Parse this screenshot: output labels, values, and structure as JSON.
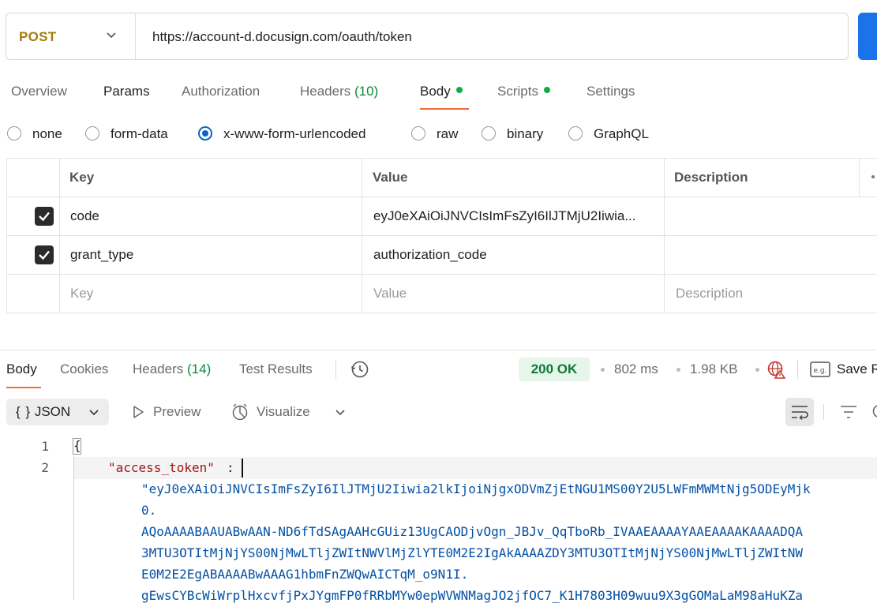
{
  "request": {
    "method": "POST",
    "url": "https://account-d.docusign.com/oauth/token"
  },
  "request_tabs": {
    "overview": "Overview",
    "params": "Params",
    "authorization": "Authorization",
    "headers": "Headers",
    "headers_count": "(10)",
    "body": "Body",
    "scripts": "Scripts",
    "settings": "Settings"
  },
  "body_types": {
    "none": "none",
    "form_data": "form-data",
    "urlencoded": "x-www-form-urlencoded",
    "raw": "raw",
    "binary": "binary",
    "graphql": "GraphQL",
    "selected": "x-www-form-urlencoded"
  },
  "params_table": {
    "headers": {
      "key": "Key",
      "value": "Value",
      "description": "Description"
    },
    "rows": [
      {
        "checked": true,
        "key": "code",
        "value": "eyJ0eXAiOiJNVCIsImFsZyI6IlJTMjU2Iiwia...",
        "description": ""
      },
      {
        "checked": true,
        "key": "grant_type",
        "value": "authorization_code",
        "description": ""
      }
    ],
    "placeholders": {
      "key": "Key",
      "value": "Value",
      "description": "Description"
    }
  },
  "response_tabs": {
    "body": "Body",
    "cookies": "Cookies",
    "headers": "Headers",
    "headers_count": "(14)",
    "test_results": "Test Results"
  },
  "response_status": {
    "code": "200 OK",
    "time": "802 ms",
    "size": "1.98 KB",
    "save": "Save R"
  },
  "response_toolbar": {
    "format": "JSON",
    "preview": "Preview",
    "visualize": "Visualize"
  },
  "code": {
    "line_numbers": [
      "1",
      "2"
    ],
    "open_brace": "{",
    "key": "\"access_token\"",
    "colon": ":",
    "value_lines": [
      "\"eyJ0eXAiOiJNVCIsImFsZyI6IlJTMjU2Iiwia2lkIjoiNjgxODVmZjEtNGU1MS00Y2U5LWFmMWMtNjg5ODEyMjk",
      "0.",
      "AQoAAAABAAUABwAAN-ND6fTdSAgAAHcGUiz13UgCAODjvOgn_JBJv_QqTboRb_IVAAEAAAAYAAEAAAAKAAAADQA",
      "3MTU3OTItMjNjYS00NjMwLTljZWItNWVlMjZlYTE0M2E2IgAkAAAAZDY3MTU3OTItMjNjYS00NjMwLTljZWItNW",
      "E0M2E2EgABAAAABwAAAG1hbmFnZWQwAICTqM_o9N1I.",
      "gEwsCYBcWiWrplHxcvfjPxJYgmFP0fRRbMYw0epWVWNMagJO2jfOC7_K1H7803H09wuu9X3gGOMaLaM98aHuKZa"
    ]
  },
  "colors": {
    "method": "#a37d0b",
    "accent_underline": "#f26b3a",
    "success": "#0c7a36",
    "radio_selected": "#0b63c5",
    "send_button": "#1a73e8"
  }
}
